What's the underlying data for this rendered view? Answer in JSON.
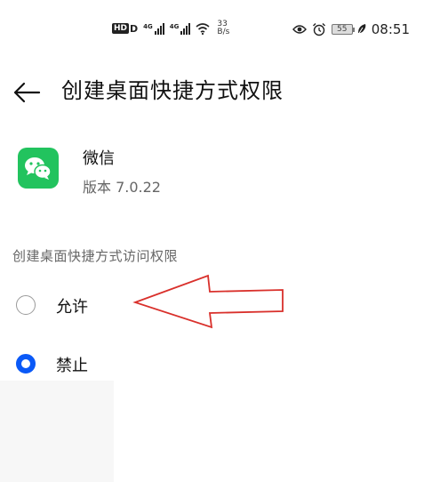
{
  "status_bar": {
    "hd_badge": "HD",
    "hd_suffix": "D",
    "sim1_network": "4G",
    "sim2_network": "4G",
    "speed_value": "33",
    "speed_unit": "B/s",
    "battery_level": "55",
    "time": "08:51",
    "icons": [
      "hd-icon",
      "signal-icon",
      "signal-icon",
      "wifi-icon",
      "eye-icon",
      "alarm-icon",
      "battery-icon",
      "leaf-icon"
    ]
  },
  "header": {
    "title": "创建桌面快捷方式权限",
    "back_icon": "arrow-left-icon"
  },
  "app": {
    "name": "微信",
    "version": "版本 7.0.22",
    "icon": "wechat-icon",
    "icon_color": "#22c35e"
  },
  "permission": {
    "section_label": "创建桌面快捷方式访问权限",
    "options": [
      {
        "label": "允许",
        "selected": false
      },
      {
        "label": "禁止",
        "selected": true
      }
    ]
  },
  "colors": {
    "accent": "#0a59f7",
    "annotation": "#d9302b"
  }
}
